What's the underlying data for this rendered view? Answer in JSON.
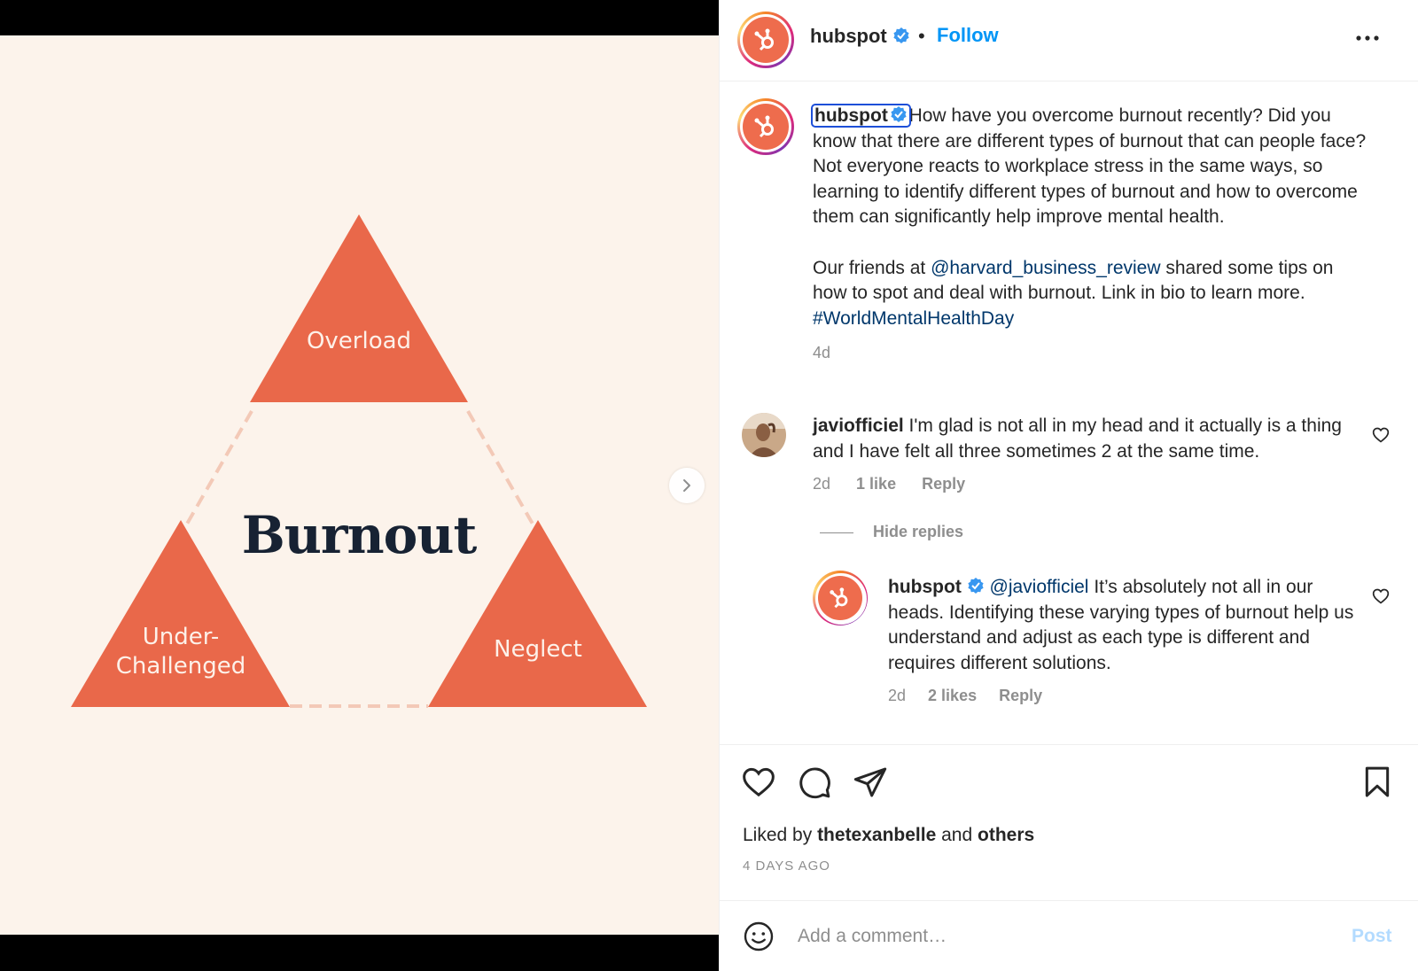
{
  "slide": {
    "labels": {
      "overload": "Overload",
      "under": "Under-\nChallenged",
      "neglect": "Neglect"
    },
    "center": "Burnout",
    "dots_total": 4,
    "dot_active": 1
  },
  "header": {
    "username": "hubspot",
    "separator": "•",
    "follow": "Follow",
    "more_icon": "more-horizontal-icon"
  },
  "caption": {
    "username": "hubspot",
    "paragraph1": "How have you overcome burnout recently? Did you know that there are different types of burnout that can people face? Not everyone reacts to workplace stress in the same ways, so learning to identify different types of burnout and how to overcome them can significantly help improve mental health.",
    "p2_before": "Our friends at ",
    "p2_mention": "@harvard_business_review",
    "p2_middle": " shared some tips on how to spot and deal with burnout. Link in bio to learn more. ",
    "p2_hashtag": "#WorldMentalHealthDay",
    "time": "4d"
  },
  "comment1": {
    "username": "javiofficiel",
    "text": " I'm glad is not all in my head and it actually is a thing and I have felt all three sometimes 2 at the same time.",
    "time": "2d",
    "likes": "1 like",
    "reply": "Reply"
  },
  "hide_replies": "Hide replies",
  "reply1": {
    "username": "hubspot",
    "mention": "@javiofficiel",
    "text": " It’s absolutely not all in our heads. Identifying these varying types of burnout help us understand and adjust as each type is different and requires different solutions.",
    "time": "2d",
    "likes": "2 likes",
    "reply": "Reply"
  },
  "actions": {
    "liked_prefix": "Liked by ",
    "liked_user": "thetexanbelle",
    "liked_and": " and ",
    "liked_others": "others",
    "ago": "4 DAYS AGO"
  },
  "add_comment": {
    "placeholder": "Add a comment…",
    "post": "Post"
  },
  "colors": {
    "triangle": "#e9684a",
    "accent": "#0095f6",
    "mention": "#00376b",
    "muted": "#8e8e8e"
  }
}
